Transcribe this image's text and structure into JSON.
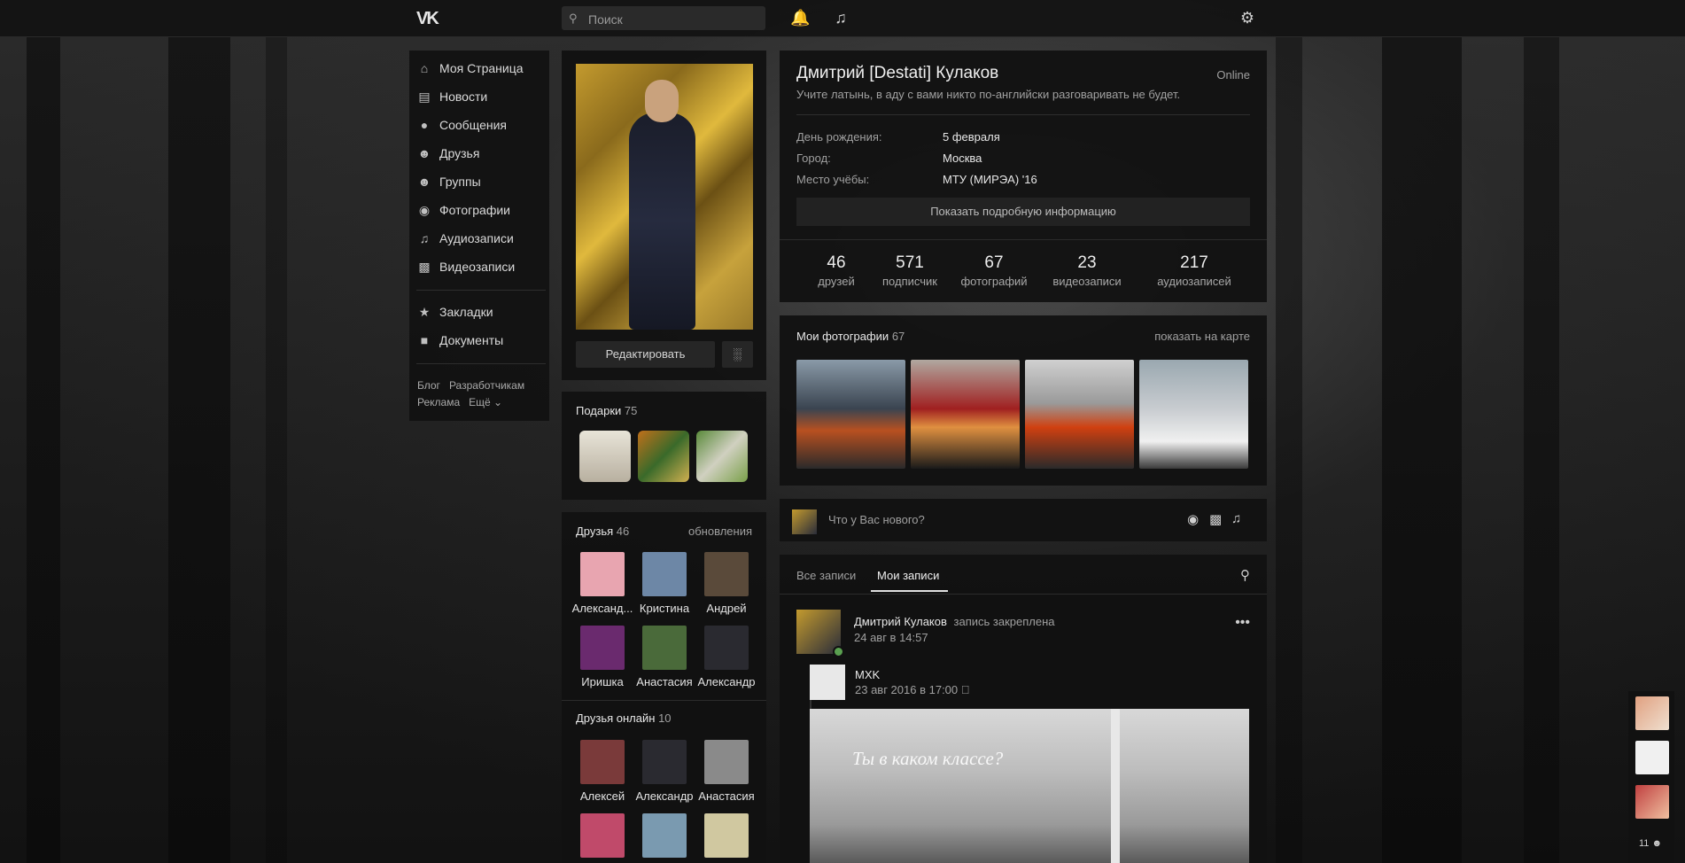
{
  "header": {
    "search_placeholder": "Поиск",
    "icons": [
      "vk-logo",
      "bell-icon",
      "music-icon",
      "gear-icon"
    ]
  },
  "menu": {
    "items": [
      {
        "label": "Моя Страница",
        "icon": "home-icon"
      },
      {
        "label": "Новости",
        "icon": "news-icon"
      },
      {
        "label": "Сообщения",
        "icon": "message-icon"
      },
      {
        "label": "Друзья",
        "icon": "user-icon"
      },
      {
        "label": "Группы",
        "icon": "group-icon"
      },
      {
        "label": "Фотографии",
        "icon": "camera-icon"
      },
      {
        "label": "Аудиозаписи",
        "icon": "music-icon"
      },
      {
        "label": "Видеозаписи",
        "icon": "film-icon"
      }
    ],
    "items2": [
      {
        "label": "Закладки",
        "icon": "star-icon"
      },
      {
        "label": "Документы",
        "icon": "document-icon"
      }
    ],
    "footer": [
      "Блог",
      "Разработчикам",
      "Реклама",
      "Ещё ⌄"
    ]
  },
  "profile": {
    "edit_label": "Редактировать",
    "name": "Дмитрий [Destati] Кулаков",
    "status_online": "Online",
    "status_text": "Учите латынь, в аду с вами никто по-английски разговаривать не будет.",
    "info": [
      {
        "label": "День рождения:",
        "value": "5 февраля"
      },
      {
        "label": "Город:",
        "value": "Москва"
      },
      {
        "label": "Место учёбы:",
        "value": "МТУ (МИРЭА) '16"
      }
    ],
    "more_info": "Показать подробную информацию",
    "counters": [
      {
        "n": "46",
        "t": "друзей"
      },
      {
        "n": "571",
        "t": "подписчик"
      },
      {
        "n": "67",
        "t": "фотографий"
      },
      {
        "n": "23",
        "t": "видеозаписи"
      },
      {
        "n": "217",
        "t": "аудиозаписей"
      }
    ]
  },
  "gifts": {
    "title": "Подарки",
    "count": "75"
  },
  "friends": {
    "title": "Друзья",
    "count": "46",
    "updates": "обновления",
    "list": [
      {
        "name": "Александ...",
        "color": "#e8a5b0"
      },
      {
        "name": "Кристина",
        "color": "#6d87a6"
      },
      {
        "name": "Андрей",
        "color": "#5a4a3a"
      },
      {
        "name": "Иришка",
        "color": "#6a2a6e"
      },
      {
        "name": "Анастасия",
        "color": "#4a6a3a"
      },
      {
        "name": "Александр",
        "color": "#2a2a30"
      }
    ]
  },
  "friends_online": {
    "title": "Друзья онлайн",
    "count": "10",
    "list": [
      {
        "name": "Алексей",
        "color": "#7a3a3a"
      },
      {
        "name": "Александр",
        "color": "#2a2a30"
      },
      {
        "name": "Анастасия",
        "color": "#8a8a8a"
      },
      {
        "name": "",
        "color": "#c04a6a"
      },
      {
        "name": "",
        "color": "#7a9ab0"
      },
      {
        "name": "",
        "color": "#d0c8a0"
      }
    ]
  },
  "photos": {
    "title": "Мои фотографии",
    "count": "67",
    "map_link": "показать на карте"
  },
  "composer": {
    "placeholder": "Что у Вас нового?"
  },
  "wall": {
    "tabs": [
      "Все записи",
      "Мои записи"
    ],
    "active_tab": 1,
    "post": {
      "author": "Дмитрий Кулаков",
      "pinned": "запись закреплена",
      "date": "24 авг в 14:57",
      "repost_author": "MXK",
      "repost_date": "23 авг 2016 в 17:00",
      "image_caption": "Ты в каком классе?"
    }
  },
  "chat": {
    "count": "11"
  }
}
